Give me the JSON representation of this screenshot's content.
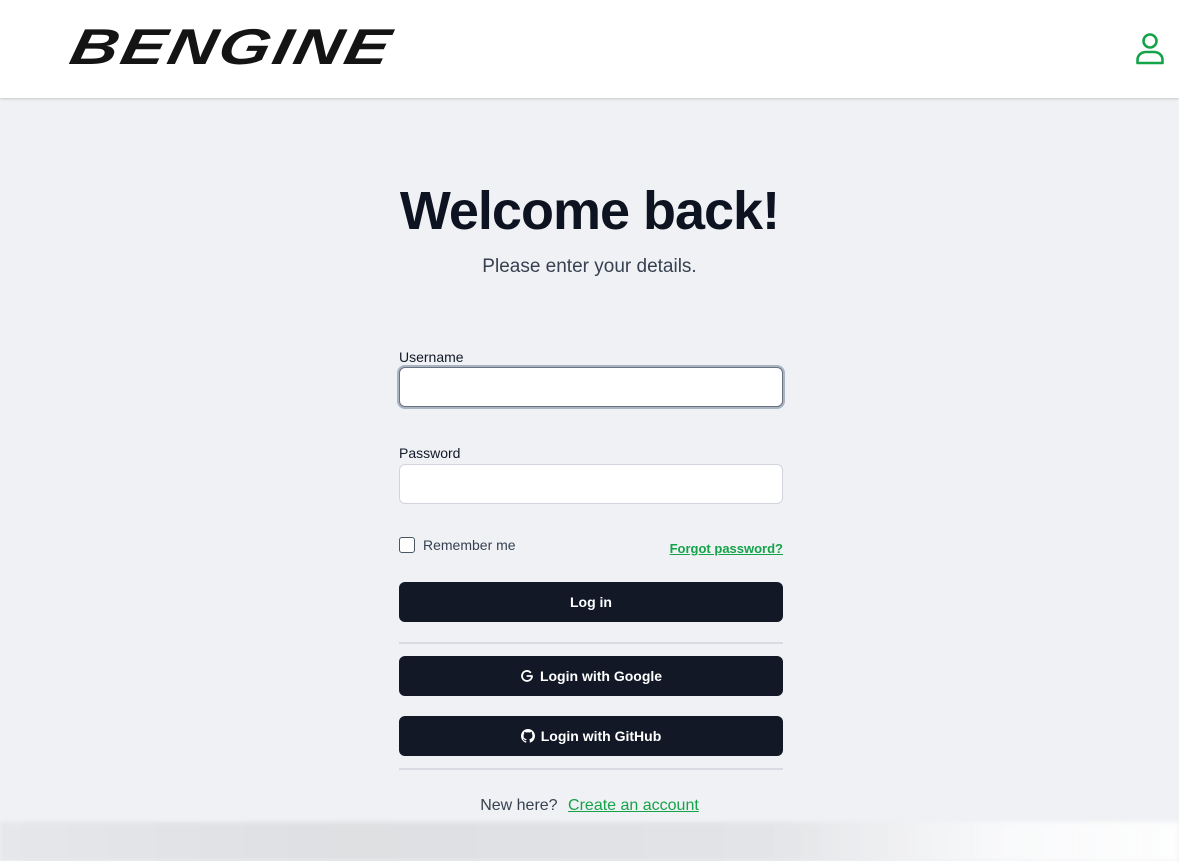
{
  "header": {
    "logo_text": "BENGINE",
    "user_icon": "user-icon"
  },
  "main": {
    "title": "Welcome back!",
    "subtitle": "Please enter your details."
  },
  "form": {
    "username_label": "Username",
    "username_value": "",
    "password_label": "Password",
    "password_value": "",
    "remember_label": "Remember me",
    "remember_checked": false,
    "forgot_label": "Forgot password?",
    "login_label": "Log in",
    "google_label": "Login with Google",
    "google_icon": "google-icon",
    "github_label": "Login with GitHub",
    "github_icon": "github-icon"
  },
  "footer": {
    "new_here": "New here?",
    "create_account": "Create an account"
  },
  "colors": {
    "accent": "#15a34a",
    "button_bg": "#121826",
    "page_bg": "#eff1f4"
  }
}
